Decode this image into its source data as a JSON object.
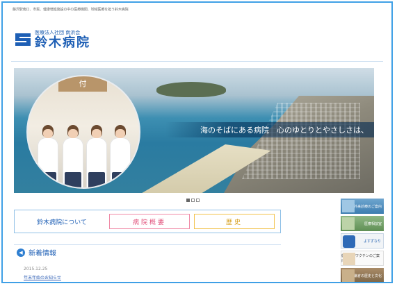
{
  "header": {
    "tagline": "藤沢駅南口、市民、健康増進施設の中の医療機関、地域医療を担う鈴木病院",
    "logo_sub": "医療法人社団 南浜会",
    "logo_name": "鈴木病院",
    "logo_icon": "s-logo-icon"
  },
  "hero": {
    "caption": "海のそばにある病院　心のゆとりとやさしさは、",
    "photo_sign": "付",
    "slide_count": 3,
    "active_slide": 1
  },
  "about": {
    "label": "鈴木病院について",
    "btn_overview": "病院概要",
    "btn_history": "歴史"
  },
  "news": {
    "title": "新着情報",
    "icon": "megaphone-icon",
    "items": [
      {
        "date": "2015.12.25",
        "title": "年末年始のお知らせ"
      }
    ]
  },
  "banners": [
    {
      "label": "外来診療のご案内"
    },
    {
      "label": "医療相談室"
    },
    {
      "label": "よすずなり"
    },
    {
      "label": "健診業務ワクチンのご案内"
    },
    {
      "label": "鎌倉の歴史と文化"
    }
  ],
  "colors": {
    "border": "#3fa0e6",
    "brand_blue": "#1e5fb5",
    "pink": "#f08aa6",
    "gold": "#f2c24a"
  }
}
